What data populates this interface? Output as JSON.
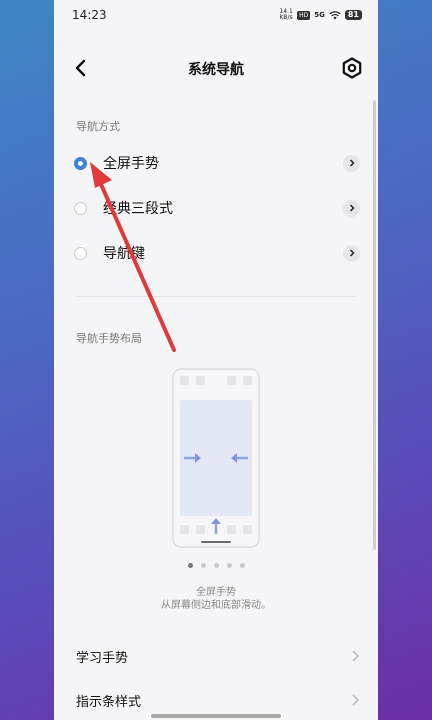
{
  "status": {
    "time": "14:23",
    "net_speed_top": "14.1",
    "net_speed_bottom": "KB/s",
    "hd": "HD",
    "signal": "5G",
    "battery": "81"
  },
  "header": {
    "title": "系统导航"
  },
  "section1": {
    "label": "导航方式",
    "options": [
      {
        "label": "全屏手势",
        "selected": true
      },
      {
        "label": "经典三段式",
        "selected": false
      },
      {
        "label": "导航键",
        "selected": false
      }
    ]
  },
  "section2": {
    "label": "导航手势布局",
    "carousel_index": 0,
    "carousel_count": 5,
    "caption_title": "全屏手势",
    "caption_text": "从屏幕侧边和底部滑动。"
  },
  "rows": [
    {
      "label": "学习手势"
    },
    {
      "label": "指示条样式"
    }
  ],
  "colors": {
    "accent": "#3e7fd8",
    "annotation_arrow": "#e03a3a"
  }
}
